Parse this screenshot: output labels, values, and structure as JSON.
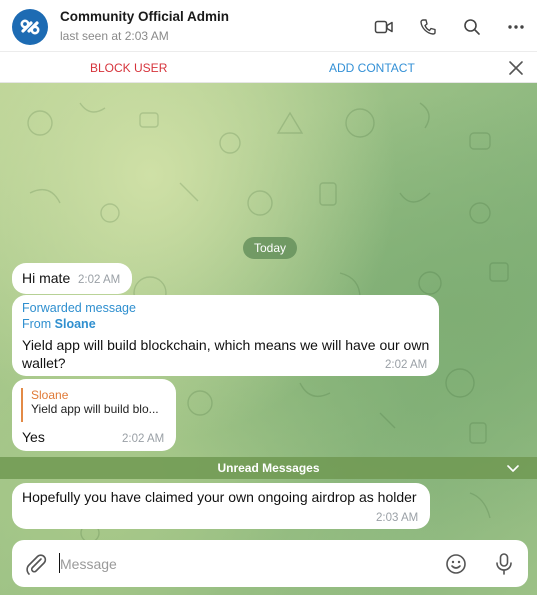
{
  "header": {
    "title": "Community Official Admin",
    "subtitle": "last seen at 2:03 AM"
  },
  "action_bar": {
    "block_user": "BLOCK USER",
    "add_contact": "ADD CONTACT"
  },
  "chat": {
    "date_separator": "Today",
    "messages": [
      {
        "text": "Hi mate",
        "time": "2:02 AM"
      },
      {
        "forwarded_label": "Forwarded message",
        "forwarded_from_prefix": "From",
        "forwarded_from_name": "Sloane",
        "text_line1": "Yield app will build blockchain, which means we will have our own",
        "text_line2": "wallet?",
        "time": "2:02 AM"
      },
      {
        "reply_name": "Sloane",
        "reply_text": "Yield app will build blo...",
        "text": "Yes",
        "time": "2:02 AM"
      },
      {
        "text": "Hopefully you have claimed your own ongoing airdrop as holder",
        "time": "2:03 AM"
      }
    ],
    "unread_label": "Unread Messages"
  },
  "composer": {
    "placeholder": "Message"
  },
  "colors": {
    "accent": "#3390d6",
    "danger": "#d6333b",
    "avatar": "#1d6bb3",
    "reply_accent": "#e07a37"
  },
  "icons": [
    "video-call-icon",
    "phone-icon",
    "search-icon",
    "more-icon",
    "close-icon",
    "chevron-down-icon",
    "attach-icon",
    "emoji-icon",
    "microphone-icon"
  ]
}
